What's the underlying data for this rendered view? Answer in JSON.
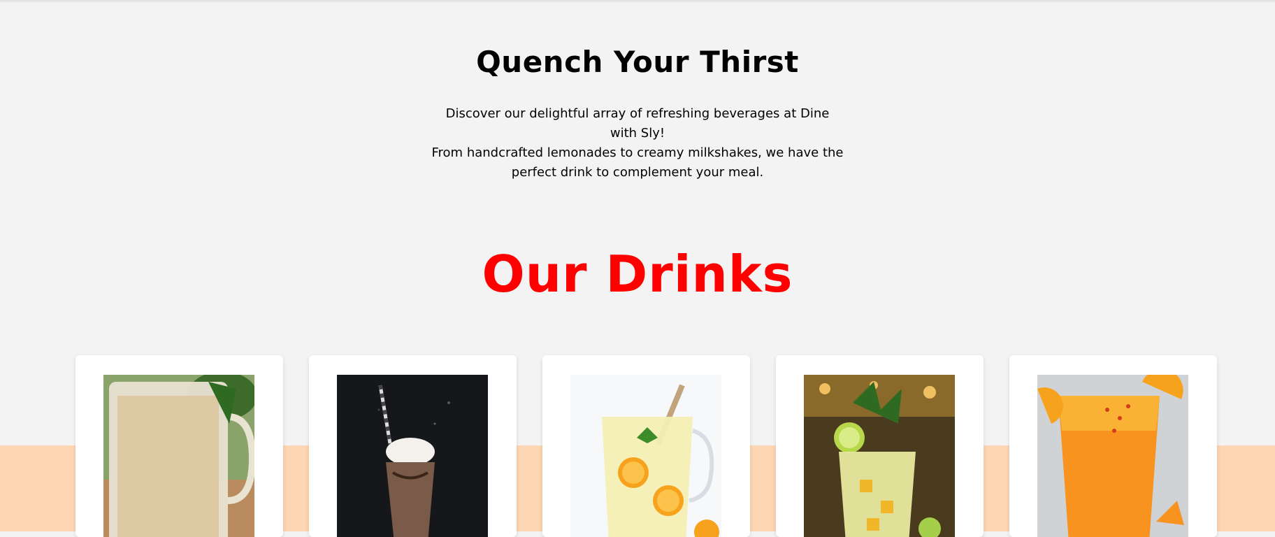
{
  "intro": {
    "title": "Quench Your Thirst",
    "line1": "Discover our delightful array of refreshing beverages at Dine with Sly!",
    "line2": "From handcrafted lemonades to creamy milkshakes, we have the perfect drink to complement your meal."
  },
  "drinks": {
    "title": "Our Drinks",
    "items": [
      {
        "image": "creamy-drink-in-mug"
      },
      {
        "image": "chocolate-milkshake"
      },
      {
        "image": "orange-lemonade-pitcher"
      },
      {
        "image": "mojito-cocktail"
      },
      {
        "image": "orange-juice-cocktail"
      }
    ]
  },
  "colors": {
    "background": "#f3f3f3",
    "band": "#fdd6b3",
    "accent": "#ff0000"
  }
}
